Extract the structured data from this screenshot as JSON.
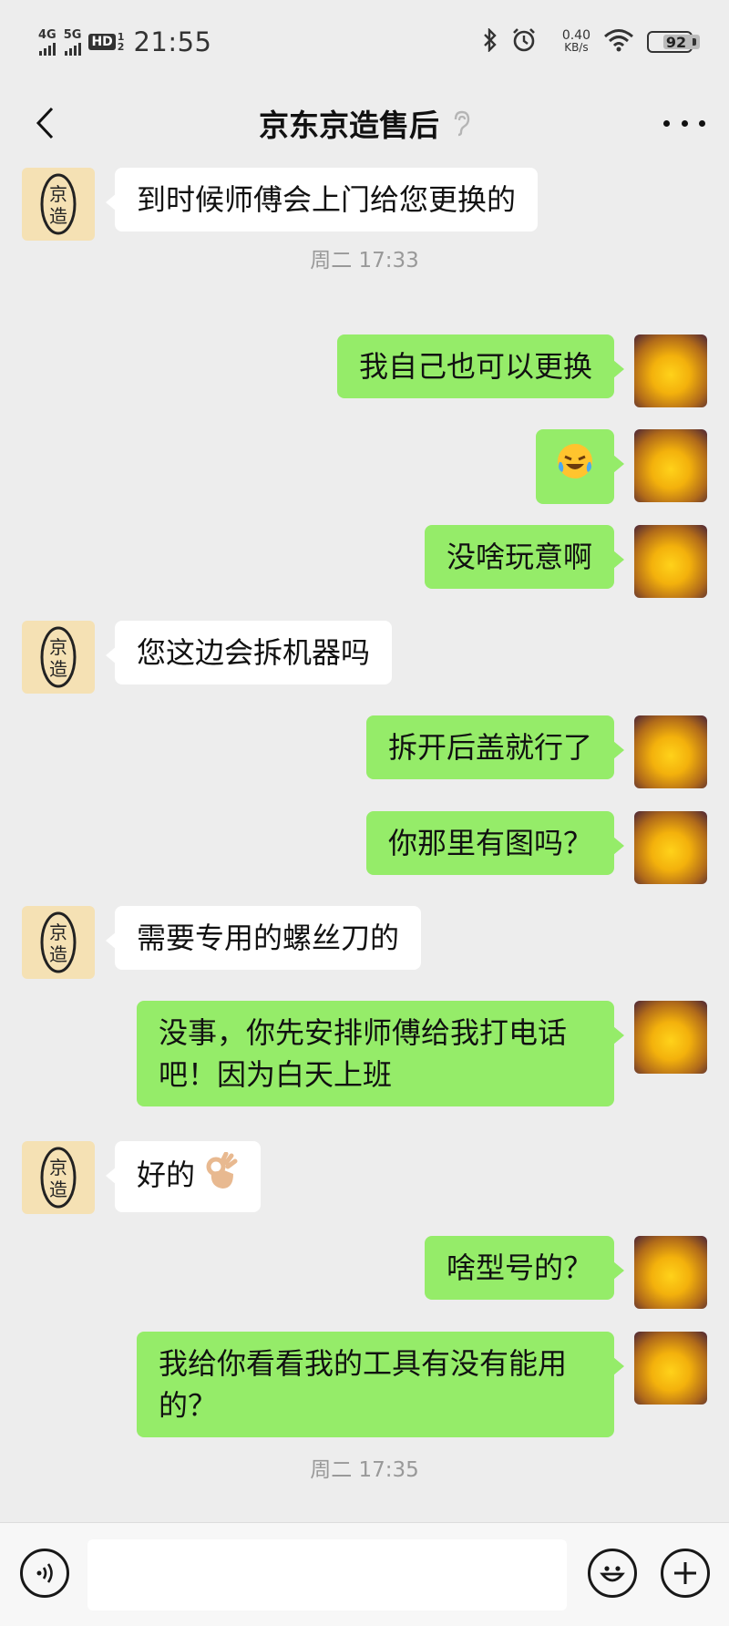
{
  "status_bar": {
    "net1": "4G",
    "net2": "5G",
    "hd": "HD",
    "hd_sub_top": "1",
    "hd_sub_bottom": "2",
    "time": "21:55",
    "speed_value": "0.40",
    "speed_unit": "KB/s",
    "battery": "92",
    "icons": [
      "bluetooth-icon",
      "alarm-icon",
      "wifi-icon",
      "battery-icon"
    ]
  },
  "nav": {
    "title": "京东京造售后",
    "icons": [
      "back-icon",
      "ear-icon",
      "more-icon"
    ]
  },
  "messages": [
    {
      "side": "left",
      "text": "到时候师傅会上门给您更换的"
    },
    {
      "side": "timestamp",
      "text": "周二 17:33"
    },
    {
      "side": "right",
      "text": "我自己也可以更换"
    },
    {
      "side": "right",
      "text": "",
      "emoji": "laughing-crying-emoji"
    },
    {
      "side": "right",
      "text": "没啥玩意啊"
    },
    {
      "side": "left",
      "text": "您这边会拆机器吗"
    },
    {
      "side": "right",
      "text": "拆开后盖就行了"
    },
    {
      "side": "right",
      "text": "你那里有图吗？"
    },
    {
      "side": "left",
      "text": "需要专用的螺丝刀的"
    },
    {
      "side": "right",
      "text_line1": "没事，你先安排师傅给我打电话",
      "text_line2": "吧！因为白天上班"
    },
    {
      "side": "left",
      "text": "好的",
      "emoji": "ok-hand-emoji"
    },
    {
      "side": "right",
      "text": "啥型号的？"
    },
    {
      "side": "right",
      "text_line1": "我给你看看我的工具有没有能用",
      "text_line2": "的？"
    },
    {
      "side": "timestamp",
      "text": "周二 17:35"
    }
  ],
  "avatars": {
    "left_text": "京造",
    "left_color": "#f5e1b4",
    "right_color": "#f3b10c"
  },
  "colors": {
    "background": "#ededed",
    "bubble_right": "#95ec69",
    "bubble_left": "#ffffff",
    "timestamp": "#999999"
  },
  "input_bar": {
    "placeholder": "",
    "icons": [
      "voice-icon",
      "emoji-icon",
      "plus-icon"
    ]
  }
}
